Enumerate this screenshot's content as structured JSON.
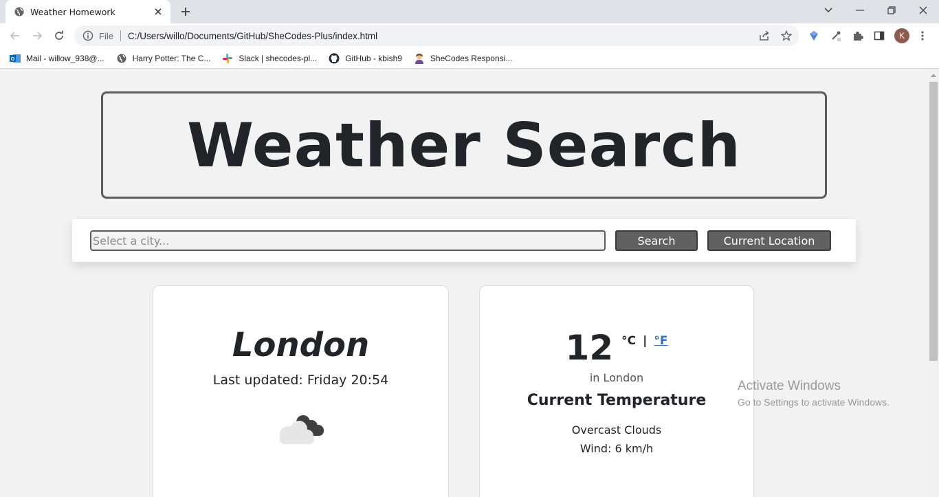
{
  "browser": {
    "tab_title": "Weather Homework",
    "omnibox_scheme": "File",
    "url": "C:/Users/willo/Documents/GitHub/SheCodes-Plus/index.html",
    "profile_initial": "K",
    "bookmarks": [
      {
        "label": "Mail - willow_938@...",
        "icon": "outlook-icon"
      },
      {
        "label": "Harry Potter: The C...",
        "icon": "globe-icon"
      },
      {
        "label": "Slack | shecodes-pl...",
        "icon": "slack-icon"
      },
      {
        "label": "GitHub - kbish9",
        "icon": "github-icon"
      },
      {
        "label": "SheCodes Responsi...",
        "icon": "shecodes-icon"
      }
    ]
  },
  "page": {
    "title": "Weather Search",
    "search": {
      "placeholder": "Select a city...",
      "search_label": "Search",
      "location_label": "Current Location"
    },
    "city_card": {
      "city": "London",
      "last_updated": "Last updated: Friday 20:54",
      "icon": "cloud-icon"
    },
    "temp_card": {
      "temperature": "12",
      "unit_c": "°C",
      "unit_separator": "|",
      "unit_f": "°F",
      "in_city": "in London",
      "label": "Current Temperature",
      "description": "Overcast Clouds",
      "wind": "Wind: 6 km/h"
    }
  },
  "os": {
    "activate_title": "Activate Windows",
    "activate_sub": "Go to Settings to activate Windows."
  },
  "colors": {
    "button_bg": "#63615f",
    "link_blue": "#2a6fd6",
    "text_dark": "#212529"
  }
}
